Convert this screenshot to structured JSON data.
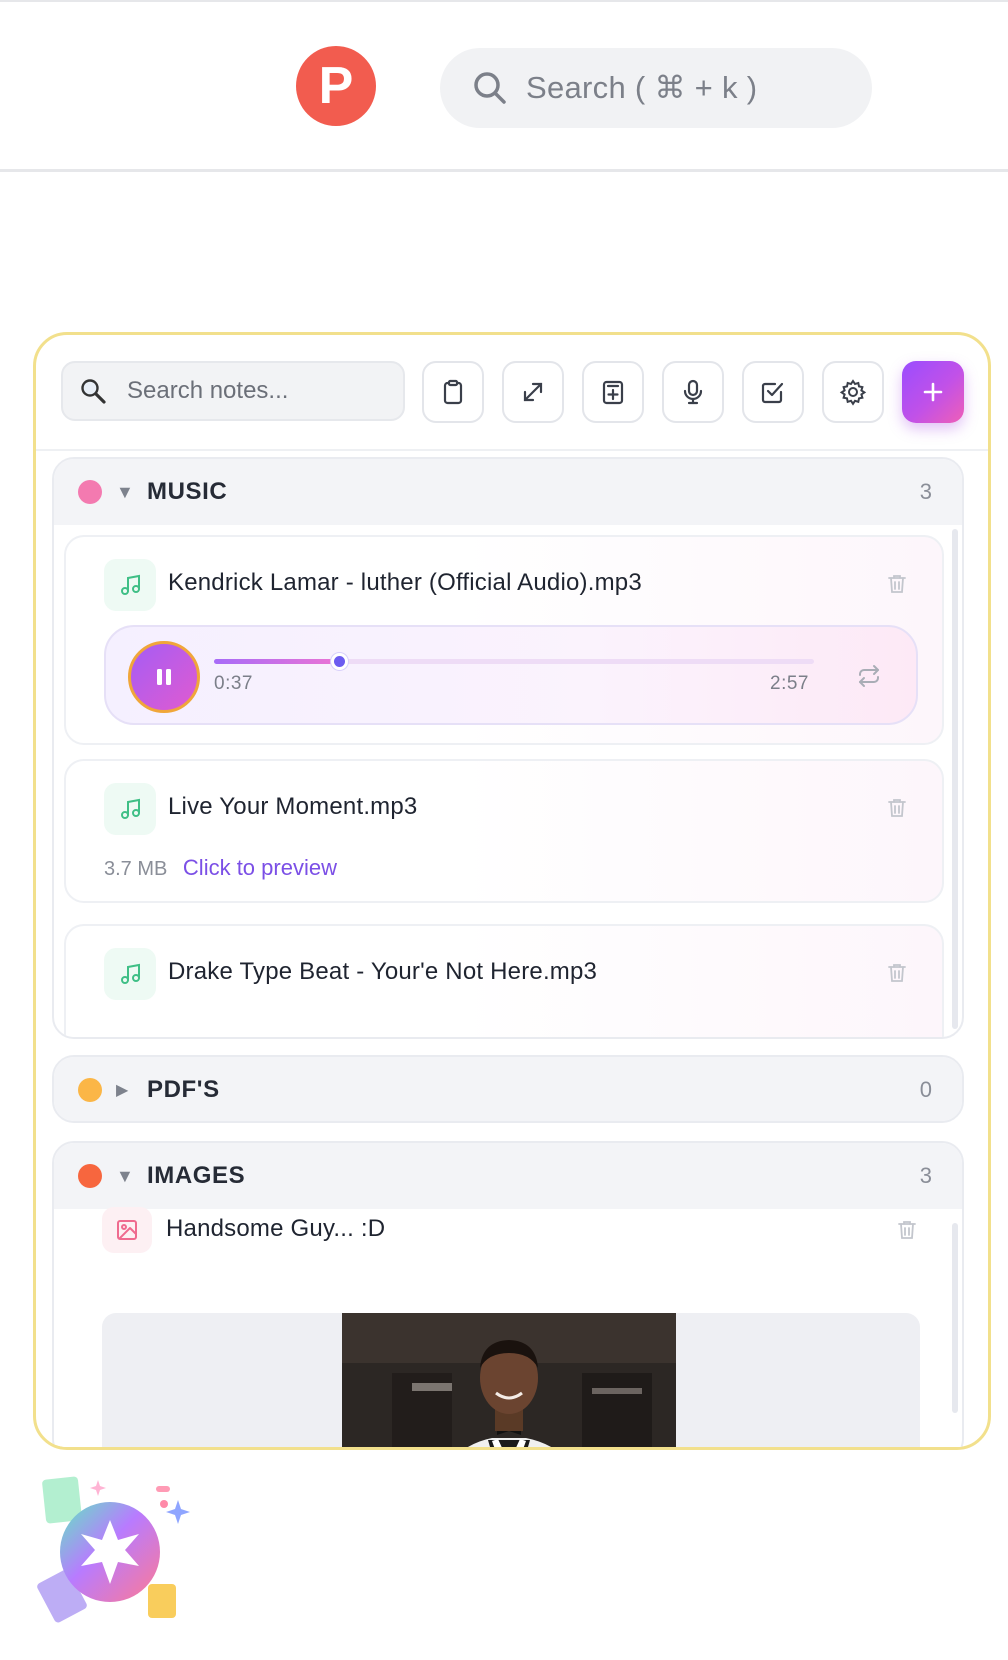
{
  "header": {
    "logo_letter": "P",
    "search_placeholder": "Search ( ⌘ + k )"
  },
  "toolbar": {
    "search_placeholder": "Search notes...",
    "buttons": [
      "clipboard-icon",
      "expand-icon",
      "new-note-icon",
      "microphone-icon",
      "checkbox-icon",
      "gear-icon",
      "plus-icon"
    ]
  },
  "categories": [
    {
      "name": "MUSIC",
      "count": "3",
      "color": "#f37ab0",
      "expanded": true,
      "notes": [
        {
          "title": "Kendrick Lamar - luther (Official Audio).mp3",
          "type": "audio",
          "player": {
            "state": "playing",
            "current": "0:37",
            "duration": "2:57",
            "progress": 0.209
          }
        },
        {
          "title": "Live Your Moment.mp3",
          "type": "audio",
          "size": "3.7 MB",
          "action": "Click to preview"
        },
        {
          "title": "Drake Type Beat - Your'e Not Here.mp3",
          "type": "audio"
        }
      ]
    },
    {
      "name": "PDF'S",
      "count": "0",
      "color": "#fbb647",
      "expanded": false
    },
    {
      "name": "IMAGES",
      "count": "3",
      "color": "#f7663e",
      "expanded": true,
      "notes": [
        {
          "title": "Handsome Guy... :D",
          "type": "image"
        }
      ]
    }
  ],
  "colors": {
    "accent": "#7b4fe6",
    "panel_border": "#f2e08c",
    "logo": "#f25c4f"
  }
}
